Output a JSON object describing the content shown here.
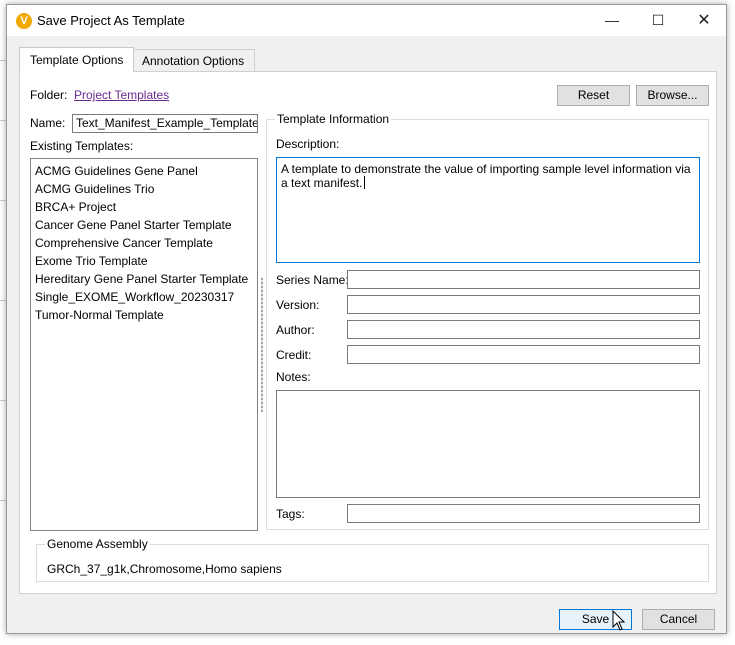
{
  "window": {
    "title": "Save Project As Template",
    "logo_letter": "V"
  },
  "tabs": [
    {
      "label": "Template Options"
    },
    {
      "label": "Annotation Options"
    }
  ],
  "folder": {
    "label": "Folder:",
    "link": "Project Templates"
  },
  "buttons": {
    "reset": "Reset",
    "browse": "Browse...",
    "save": "Save",
    "cancel": "Cancel"
  },
  "name": {
    "label": "Name:",
    "value": "Text_Manifest_Example_Template"
  },
  "existing": {
    "label": "Existing Templates:",
    "items": [
      "ACMG Guidelines Gene Panel",
      "ACMG Guidelines Trio",
      "BRCA+ Project",
      "Cancer Gene Panel Starter Template",
      "Comprehensive Cancer Template",
      "Exome Trio Template",
      "Hereditary Gene Panel Starter Template",
      "Single_EXOME_Workflow_20230317",
      "Tumor-Normal Template"
    ]
  },
  "info": {
    "title": "Template Information",
    "description_label": "Description:",
    "description_value": "A template to demonstrate the value of importing sample level information via a text manifest.",
    "series_label": "Series Name:",
    "version_label": "Version:",
    "author_label": "Author:",
    "credit_label": "Credit:",
    "notes_label": "Notes:",
    "tags_label": "Tags:"
  },
  "genome": {
    "title": "Genome Assembly",
    "value": "GRCh_37_g1k,Chromosome,Homo sapiens"
  },
  "colors": {
    "accent": "#0078d7",
    "link": "#6b2b8f",
    "logo": "#f2a900"
  }
}
